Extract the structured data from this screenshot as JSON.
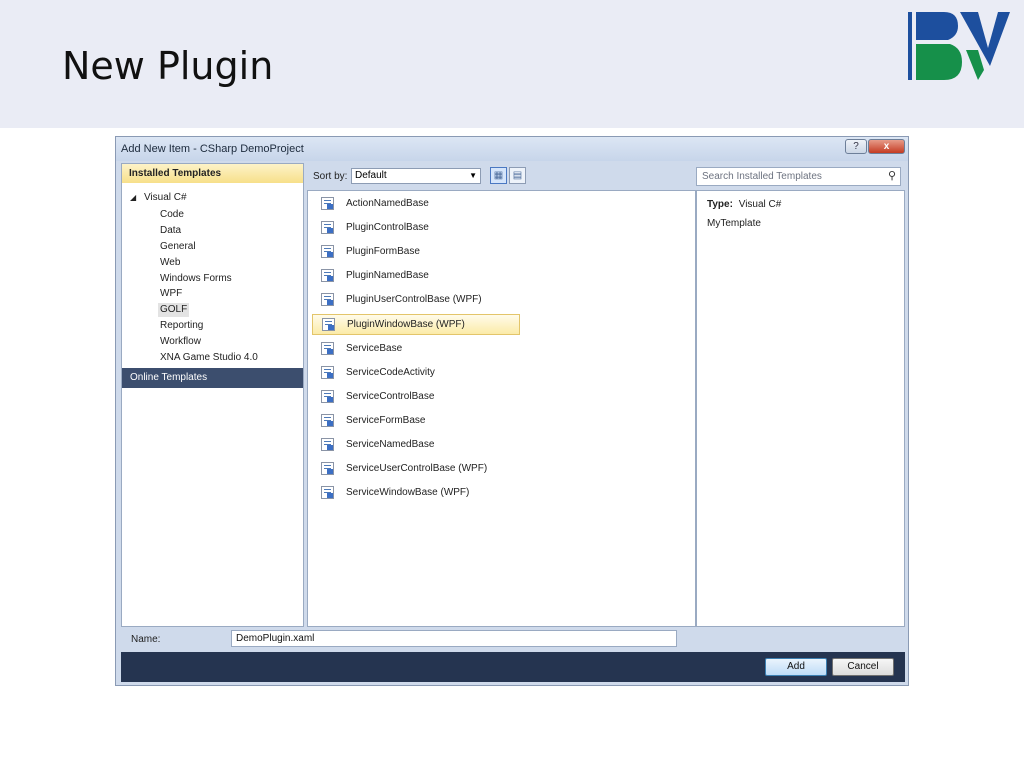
{
  "slide": {
    "title": "New Plugin"
  },
  "dialog": {
    "title": "Add New Item - CSharp DemoProject",
    "help_label": "?",
    "close_label": "x",
    "left_pane": {
      "installed_header": "Installed Templates",
      "tree_root": "Visual C#",
      "tree_items": [
        "Code",
        "Data",
        "General",
        "Web",
        "Windows Forms",
        "WPF",
        "GOLF",
        "Reporting",
        "Workflow",
        "XNA Game Studio 4.0"
      ],
      "selected_item": "GOLF",
      "online_templates": "Online Templates"
    },
    "toolbar": {
      "sort_label": "Sort by:",
      "sort_value": "Default"
    },
    "search": {
      "placeholder": "Search Installed Templates"
    },
    "templates": [
      "ActionNamedBase",
      "PluginControlBase",
      "PluginFormBase",
      "PluginNamedBase",
      "PluginUserControlBase (WPF)",
      "PluginWindowBase (WPF)",
      "ServiceBase",
      "ServiceCodeActivity",
      "ServiceControlBase",
      "ServiceFormBase",
      "ServiceNamedBase",
      "ServiceUserControlBase (WPF)",
      "ServiceWindowBase (WPF)"
    ],
    "selected_template": "PluginWindowBase (WPF)",
    "details": {
      "type_label": "Type:",
      "type_value": "Visual C#",
      "template_name": "MyTemplate"
    },
    "name_field": {
      "label": "Name:",
      "value": "DemoPlugin.xaml"
    },
    "buttons": {
      "add": "Add",
      "cancel": "Cancel"
    }
  },
  "colors": {
    "header_bg": "#eaecf5",
    "logo_blue": "#1d4f9e",
    "logo_green": "#16904a",
    "footer_bg": "#253450"
  },
  "icons": {
    "logo": "bv-logo",
    "search": "search-icon",
    "template": "template-file-icon"
  }
}
